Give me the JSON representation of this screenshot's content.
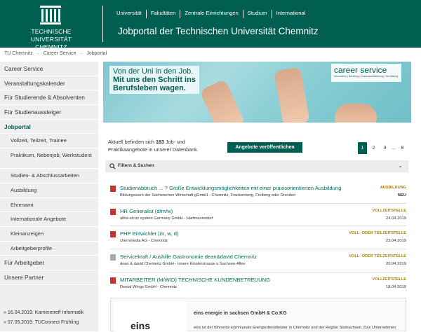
{
  "university": {
    "name_line1": "TECHNISCHE UNIVERSITÄT",
    "name_line2": "CHEMNITZ"
  },
  "topnav": [
    "Universität",
    "Fakultäten",
    "Zentrale Einrichtungen",
    "Studium",
    "International"
  ],
  "portal_title": "Jobportal der Technischen Universität Chemnitz",
  "breadcrumb": [
    "TU Chemnitz",
    "Career Service",
    "Jobportal"
  ],
  "breadcrumb_sep": "→",
  "sidebar": {
    "items": [
      {
        "label": "Career Service"
      },
      {
        "label": "Veranstaltungskalender"
      },
      {
        "label": "Für Studierende & Absolventen"
      },
      {
        "label": "Für Studienaussteiger"
      },
      {
        "label": "Jobportal"
      },
      {
        "label": "Vollzeit, Teilzeit, Trainee"
      },
      {
        "label": "Praktikum, Nebenjob, Werkstudent"
      },
      {
        "label": "Studien- & Abschlussarbeiten"
      },
      {
        "label": "Ausbildung"
      },
      {
        "label": "Ehrenamt"
      },
      {
        "label": "Internationale Angebote"
      },
      {
        "label": "Kleinanzeigen"
      },
      {
        "label": "Arbeitgeberprofile"
      },
      {
        "label": "Für Arbeitgeber"
      },
      {
        "label": "Unsere Partner"
      }
    ]
  },
  "news": [
    "» 16.04.2019: Karrieretreff Informatik",
    "» 07.05.2019: TUConnect Frühling"
  ],
  "banner": {
    "line1": "Von der Uni in den Job.",
    "line2": "Mit uns den Schritt ins",
    "line3": "Berufsleben wagen.",
    "cs_title": "career service",
    "cs_sub": "Information | Beratung | Zusatzqualifizierung | Vermittlung"
  },
  "count": {
    "prefix": "Aktuell befinden sich",
    "number": "183",
    "suffix": "Job- und Praktikaangebote in unserer Datenbank."
  },
  "publish_label": "Angebote veröffentlichen",
  "pager": [
    "1",
    "2",
    "3",
    "...",
    "8"
  ],
  "filter_label": "Filtern & Suchen",
  "jobs": [
    {
      "title": "Studienabbruch ... ? Große Entwicklungsmöglichkeiten mit einer praxisorientierten Ausbildung",
      "company": "Bildungswerk der Sächsischen Wirtschaft gGmbH - Chemnitz, Frankenberg, Freiberg oder Dresden",
      "type": "AUSBILDUNG",
      "date": "NEU",
      "icon": "pdf"
    },
    {
      "title": "HR Generalist (d/m/w)",
      "company": "albis-elcon system Germany GmbH - Hartmannsdorf",
      "type": "VOLLZEITSTELLE",
      "date": "24.04.2019",
      "icon": "pdf"
    },
    {
      "title": "PHP Entwickler (m, w, d)",
      "company": "chemmedia AG - Chemnitz",
      "type": "VOLL- ODER TEILZEITSTELLE",
      "date": "23.04.2019",
      "icon": "pdf"
    },
    {
      "title": "Servicekraft / Aushilfe Gastronomie dean&david Chemnitz",
      "company": "dean & david Chemnitz GmbH - Innere Klosterstrasse u Sachsen-Allee",
      "type": "VOLL- ODER TEILZEITSTELLE",
      "date": "20.04.2019",
      "icon": "doc"
    },
    {
      "title": "MITARBEITER (M/W/D) TECHNISCHE KUNDENBETREUUNG",
      "company": "Dental Wings GmbH - Chemnitz",
      "type": "VOLLZEITSTELLE",
      "date": "18.04.2019",
      "icon": "pdf"
    }
  ],
  "ad": {
    "logo": "eins",
    "name": "eins energie in sachsen GmbH & Co.KG",
    "desc": "eins ist der führende kommunale Energiedienstleister in Chemnitz und der Region Südsachsen. Das Unternehmen"
  },
  "colors": {
    "brand": "#005f50",
    "job_link": "#006a58",
    "type_label": "#b37e00"
  }
}
